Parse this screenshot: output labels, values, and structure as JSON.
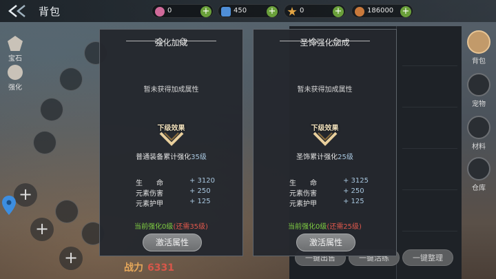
{
  "header": {
    "title": "背包",
    "resources": [
      {
        "icon": "pink-gem-icon",
        "value": "0",
        "color": "#d06a9a"
      },
      {
        "icon": "blue-crystal-icon",
        "value": "450",
        "color": "#4f8fd8"
      },
      {
        "icon": "gold-star-icon",
        "value": "0",
        "color": "#e2a443"
      },
      {
        "icon": "copper-coin-icon",
        "value": "186000",
        "color": "#c9793b"
      }
    ]
  },
  "left_tabs": [
    {
      "label": "宝石"
    },
    {
      "label": "强化"
    }
  ],
  "right_tabs": [
    {
      "label": "背包",
      "active": true
    },
    {
      "label": "宠物"
    },
    {
      "label": "材料"
    },
    {
      "label": "仓库"
    }
  ],
  "power": {
    "value": "6331"
  },
  "bottom_buttons": [
    "一键出售",
    "一键活练",
    "一键整理"
  ],
  "panels": [
    {
      "title": "强化加成",
      "none_text": "暂未获得加成属性",
      "next_label": "下级效果",
      "requirement_prefix": "普通装备累计强化",
      "requirement_value": "35级",
      "stats": [
        {
          "name": "生　　命",
          "value": "+ 3120"
        },
        {
          "name": "元素伤害",
          "value": "+ 250"
        },
        {
          "name": "元素护甲",
          "value": "+ 125"
        }
      ],
      "current_prefix": "当前强化0级",
      "current_need": "(还需35级)",
      "button": "激活属性"
    },
    {
      "title": "圣饰强化加成",
      "none_text": "暂未获得加成属性",
      "next_label": "下级效果",
      "requirement_prefix": "圣饰累计强化",
      "requirement_value": "25级",
      "stats": [
        {
          "name": "生　　命",
          "value": "+ 3125"
        },
        {
          "name": "元素伤害",
          "value": "+ 250"
        },
        {
          "name": "元素护甲",
          "value": "+ 125"
        }
      ],
      "current_prefix": "当前强化0级",
      "current_need": "(还需25级)",
      "button": "激活属性"
    }
  ]
}
